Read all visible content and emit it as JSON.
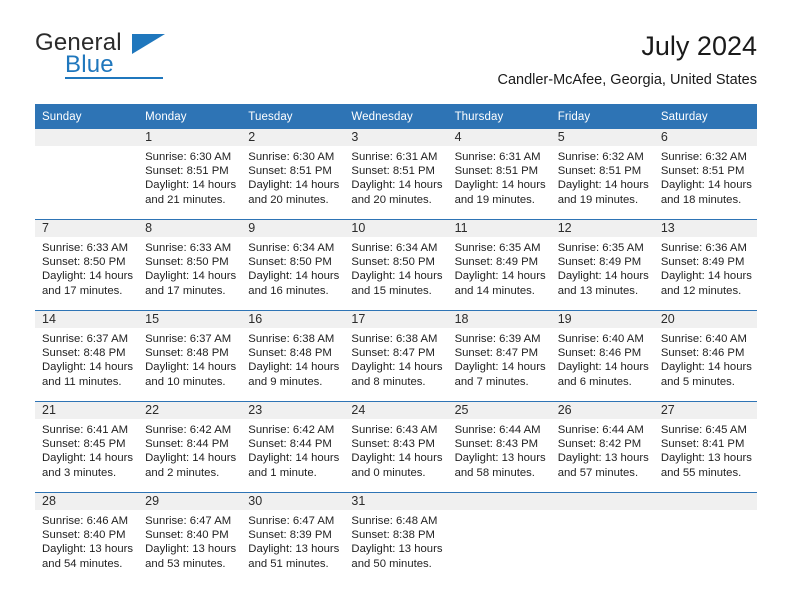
{
  "brand": {
    "line1": "General",
    "line2": "Blue",
    "triangle_color": "#1f77bd"
  },
  "header": {
    "title": "July 2024",
    "subtitle": "Candler-McAfee, Georgia, United States",
    "accent_color": "#2e74b5",
    "band_color": "#f0f0f0"
  },
  "calendar": {
    "weekday_headers": [
      "Sunday",
      "Monday",
      "Tuesday",
      "Wednesday",
      "Thursday",
      "Friday",
      "Saturday"
    ],
    "weeks": [
      [
        {
          "day": "",
          "sunrise": "",
          "sunset": "",
          "daylight_line1": "",
          "daylight_line2": "",
          "empty": true
        },
        {
          "day": "1",
          "sunrise": "Sunrise: 6:30 AM",
          "sunset": "Sunset: 8:51 PM",
          "daylight_line1": "Daylight: 14 hours",
          "daylight_line2": "and 21 minutes."
        },
        {
          "day": "2",
          "sunrise": "Sunrise: 6:30 AM",
          "sunset": "Sunset: 8:51 PM",
          "daylight_line1": "Daylight: 14 hours",
          "daylight_line2": "and 20 minutes."
        },
        {
          "day": "3",
          "sunrise": "Sunrise: 6:31 AM",
          "sunset": "Sunset: 8:51 PM",
          "daylight_line1": "Daylight: 14 hours",
          "daylight_line2": "and 20 minutes."
        },
        {
          "day": "4",
          "sunrise": "Sunrise: 6:31 AM",
          "sunset": "Sunset: 8:51 PM",
          "daylight_line1": "Daylight: 14 hours",
          "daylight_line2": "and 19 minutes."
        },
        {
          "day": "5",
          "sunrise": "Sunrise: 6:32 AM",
          "sunset": "Sunset: 8:51 PM",
          "daylight_line1": "Daylight: 14 hours",
          "daylight_line2": "and 19 minutes."
        },
        {
          "day": "6",
          "sunrise": "Sunrise: 6:32 AM",
          "sunset": "Sunset: 8:51 PM",
          "daylight_line1": "Daylight: 14 hours",
          "daylight_line2": "and 18 minutes."
        }
      ],
      [
        {
          "day": "7",
          "sunrise": "Sunrise: 6:33 AM",
          "sunset": "Sunset: 8:50 PM",
          "daylight_line1": "Daylight: 14 hours",
          "daylight_line2": "and 17 minutes."
        },
        {
          "day": "8",
          "sunrise": "Sunrise: 6:33 AM",
          "sunset": "Sunset: 8:50 PM",
          "daylight_line1": "Daylight: 14 hours",
          "daylight_line2": "and 17 minutes."
        },
        {
          "day": "9",
          "sunrise": "Sunrise: 6:34 AM",
          "sunset": "Sunset: 8:50 PM",
          "daylight_line1": "Daylight: 14 hours",
          "daylight_line2": "and 16 minutes."
        },
        {
          "day": "10",
          "sunrise": "Sunrise: 6:34 AM",
          "sunset": "Sunset: 8:50 PM",
          "daylight_line1": "Daylight: 14 hours",
          "daylight_line2": "and 15 minutes."
        },
        {
          "day": "11",
          "sunrise": "Sunrise: 6:35 AM",
          "sunset": "Sunset: 8:49 PM",
          "daylight_line1": "Daylight: 14 hours",
          "daylight_line2": "and 14 minutes."
        },
        {
          "day": "12",
          "sunrise": "Sunrise: 6:35 AM",
          "sunset": "Sunset: 8:49 PM",
          "daylight_line1": "Daylight: 14 hours",
          "daylight_line2": "and 13 minutes."
        },
        {
          "day": "13",
          "sunrise": "Sunrise: 6:36 AM",
          "sunset": "Sunset: 8:49 PM",
          "daylight_line1": "Daylight: 14 hours",
          "daylight_line2": "and 12 minutes."
        }
      ],
      [
        {
          "day": "14",
          "sunrise": "Sunrise: 6:37 AM",
          "sunset": "Sunset: 8:48 PM",
          "daylight_line1": "Daylight: 14 hours",
          "daylight_line2": "and 11 minutes."
        },
        {
          "day": "15",
          "sunrise": "Sunrise: 6:37 AM",
          "sunset": "Sunset: 8:48 PM",
          "daylight_line1": "Daylight: 14 hours",
          "daylight_line2": "and 10 minutes."
        },
        {
          "day": "16",
          "sunrise": "Sunrise: 6:38 AM",
          "sunset": "Sunset: 8:48 PM",
          "daylight_line1": "Daylight: 14 hours",
          "daylight_line2": "and 9 minutes."
        },
        {
          "day": "17",
          "sunrise": "Sunrise: 6:38 AM",
          "sunset": "Sunset: 8:47 PM",
          "daylight_line1": "Daylight: 14 hours",
          "daylight_line2": "and 8 minutes."
        },
        {
          "day": "18",
          "sunrise": "Sunrise: 6:39 AM",
          "sunset": "Sunset: 8:47 PM",
          "daylight_line1": "Daylight: 14 hours",
          "daylight_line2": "and 7 minutes."
        },
        {
          "day": "19",
          "sunrise": "Sunrise: 6:40 AM",
          "sunset": "Sunset: 8:46 PM",
          "daylight_line1": "Daylight: 14 hours",
          "daylight_line2": "and 6 minutes."
        },
        {
          "day": "20",
          "sunrise": "Sunrise: 6:40 AM",
          "sunset": "Sunset: 8:46 PM",
          "daylight_line1": "Daylight: 14 hours",
          "daylight_line2": "and 5 minutes."
        }
      ],
      [
        {
          "day": "21",
          "sunrise": "Sunrise: 6:41 AM",
          "sunset": "Sunset: 8:45 PM",
          "daylight_line1": "Daylight: 14 hours",
          "daylight_line2": "and 3 minutes."
        },
        {
          "day": "22",
          "sunrise": "Sunrise: 6:42 AM",
          "sunset": "Sunset: 8:44 PM",
          "daylight_line1": "Daylight: 14 hours",
          "daylight_line2": "and 2 minutes."
        },
        {
          "day": "23",
          "sunrise": "Sunrise: 6:42 AM",
          "sunset": "Sunset: 8:44 PM",
          "daylight_line1": "Daylight: 14 hours",
          "daylight_line2": "and 1 minute."
        },
        {
          "day": "24",
          "sunrise": "Sunrise: 6:43 AM",
          "sunset": "Sunset: 8:43 PM",
          "daylight_line1": "Daylight: 14 hours",
          "daylight_line2": "and 0 minutes."
        },
        {
          "day": "25",
          "sunrise": "Sunrise: 6:44 AM",
          "sunset": "Sunset: 8:43 PM",
          "daylight_line1": "Daylight: 13 hours",
          "daylight_line2": "and 58 minutes."
        },
        {
          "day": "26",
          "sunrise": "Sunrise: 6:44 AM",
          "sunset": "Sunset: 8:42 PM",
          "daylight_line1": "Daylight: 13 hours",
          "daylight_line2": "and 57 minutes."
        },
        {
          "day": "27",
          "sunrise": "Sunrise: 6:45 AM",
          "sunset": "Sunset: 8:41 PM",
          "daylight_line1": "Daylight: 13 hours",
          "daylight_line2": "and 55 minutes."
        }
      ],
      [
        {
          "day": "28",
          "sunrise": "Sunrise: 6:46 AM",
          "sunset": "Sunset: 8:40 PM",
          "daylight_line1": "Daylight: 13 hours",
          "daylight_line2": "and 54 minutes."
        },
        {
          "day": "29",
          "sunrise": "Sunrise: 6:47 AM",
          "sunset": "Sunset: 8:40 PM",
          "daylight_line1": "Daylight: 13 hours",
          "daylight_line2": "and 53 minutes."
        },
        {
          "day": "30",
          "sunrise": "Sunrise: 6:47 AM",
          "sunset": "Sunset: 8:39 PM",
          "daylight_line1": "Daylight: 13 hours",
          "daylight_line2": "and 51 minutes."
        },
        {
          "day": "31",
          "sunrise": "Sunrise: 6:48 AM",
          "sunset": "Sunset: 8:38 PM",
          "daylight_line1": "Daylight: 13 hours",
          "daylight_line2": "and 50 minutes."
        },
        {
          "day": "",
          "sunrise": "",
          "sunset": "",
          "daylight_line1": "",
          "daylight_line2": "",
          "empty": true
        },
        {
          "day": "",
          "sunrise": "",
          "sunset": "",
          "daylight_line1": "",
          "daylight_line2": "",
          "empty": true
        },
        {
          "day": "",
          "sunrise": "",
          "sunset": "",
          "daylight_line1": "",
          "daylight_line2": "",
          "empty": true
        }
      ]
    ]
  }
}
